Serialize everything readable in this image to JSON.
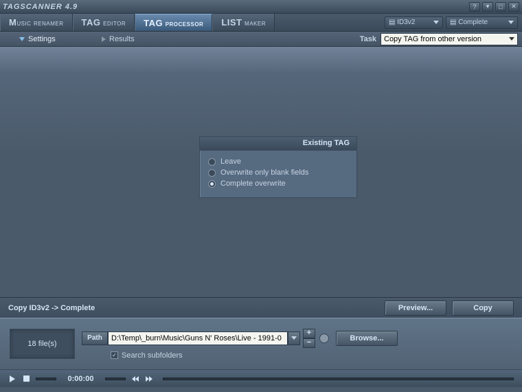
{
  "title": "TAGSCANNER 4.9",
  "tabs": {
    "t0": "MUSIC RENAMER",
    "t1": "TAG EDITOR",
    "t2": "TAG PROCESSOR",
    "t3": "LIST MAKER"
  },
  "tag_format_dropdown": "ID3v2",
  "tag_mode_dropdown": "Complete",
  "subtabs": {
    "settings": "Settings",
    "results": "Results"
  },
  "task_label": "Task",
  "task_value": "Copy TAG from other version",
  "panel": {
    "title": "Existing TAG",
    "opt0": "Leave",
    "opt1": "Overwrite only blank fields",
    "opt2": "Complete overwrite"
  },
  "status_text": "Copy ID3v2 -> Complete",
  "preview_btn": "Preview...",
  "copy_btn": "Copy",
  "file_count": "18 file(s)",
  "path_label": "Path",
  "path_value": "D:\\Temp\\_burn\\Music\\Guns N' Roses\\Live - 1991-0",
  "browse_btn": "Browse...",
  "search_subfolders": "Search subfolders",
  "player_time": "0:00:00"
}
